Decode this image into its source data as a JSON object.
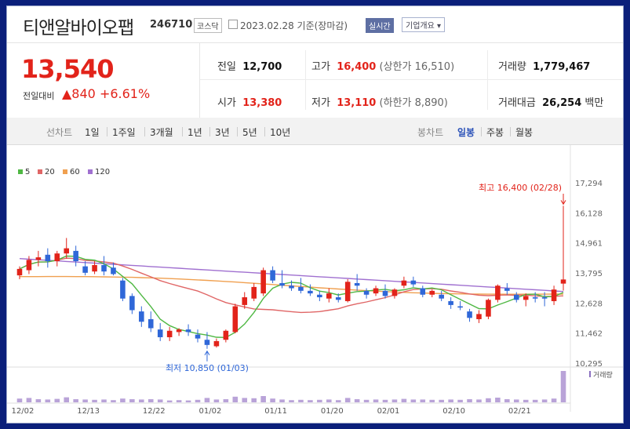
{
  "company": {
    "name": "티앤알바이오팹",
    "code": "246710",
    "market": "코스닥",
    "date": "2023.02.28",
    "basis": "기준(장마감)",
    "realtime": "실시간",
    "corp_overview": "기업개요 ▾"
  },
  "summary": {
    "price": "13,540",
    "change_label": "전일대비",
    "change_abs": "▲840",
    "change_pct": "+6.61%",
    "prev_close_label": "전일",
    "prev_close": "12,700",
    "high_label": "고가",
    "high": "16,400",
    "upper_limit_label": "(상한가",
    "upper_limit": "16,510)",
    "volume_label": "거래량",
    "volume": "1,779,467",
    "open_label": "시가",
    "open": "13,380",
    "low_label": "저가",
    "low": "13,110",
    "lower_limit_label": "(하한가",
    "lower_limit": "8,890)",
    "amount_label": "거래대금",
    "amount": "26,254",
    "amount_unit": "백만"
  },
  "tabs": {
    "line_label": "선차트",
    "periods": [
      "1일",
      "1주일",
      "3개월",
      "1년",
      "3년",
      "5년",
      "10년"
    ],
    "candle_label": "봉차트",
    "daily": "일봉",
    "weekly": "주봉",
    "monthly": "월봉"
  },
  "colors": {
    "up": "#e2231a",
    "down": "#2f67d8",
    "ma5": "#4fb843",
    "ma20": "#e06666",
    "ma60": "#f0a050",
    "ma120": "#a070d0",
    "volume": "#b9a3d8"
  },
  "chart_data": {
    "type": "candlestick",
    "legend": [
      {
        "name": "5",
        "color": "#4fb843"
      },
      {
        "name": "20",
        "color": "#e06666"
      },
      {
        "name": "60",
        "color": "#f0a050"
      },
      {
        "name": "120",
        "color": "#a070d0"
      }
    ],
    "y_ticks": [
      17294,
      16128,
      14961,
      13795,
      12628,
      11462,
      10295
    ],
    "ylim": [
      10295,
      17294
    ],
    "x_labels": [
      {
        "i": 0,
        "label": "12/02"
      },
      {
        "i": 7,
        "label": "12/13"
      },
      {
        "i": 14,
        "label": "12/22"
      },
      {
        "i": 20,
        "label": "01/02"
      },
      {
        "i": 27,
        "label": "01/11"
      },
      {
        "i": 33,
        "label": "01/20"
      },
      {
        "i": 39,
        "label": "02/01"
      },
      {
        "i": 46,
        "label": "02/10"
      },
      {
        "i": 53,
        "label": "02/21"
      }
    ],
    "high_annotation": "최고 16,400 (02/28)",
    "low_annotation": "최저 10,850 (01/03)",
    "volume_label": "거래량",
    "candles": [
      [
        13700,
        14050,
        13550,
        13950
      ],
      [
        13900,
        14450,
        13750,
        14300
      ],
      [
        14300,
        14650,
        14050,
        14400
      ],
      [
        14500,
        14750,
        14000,
        14250
      ],
      [
        14250,
        14650,
        14050,
        14550
      ],
      [
        14550,
        15150,
        14350,
        14750
      ],
      [
        14650,
        14850,
        14050,
        14250
      ],
      [
        14050,
        14250,
        13700,
        13800
      ],
      [
        13850,
        14250,
        13750,
        14100
      ],
      [
        14100,
        14450,
        13700,
        13850
      ],
      [
        14000,
        14200,
        13700,
        13750
      ],
      [
        13500,
        13600,
        12700,
        12800
      ],
      [
        12900,
        13000,
        12200,
        12350
      ],
      [
        12300,
        12500,
        11700,
        11900
      ],
      [
        12000,
        12300,
        11500,
        11650
      ],
      [
        11600,
        11850,
        11150,
        11300
      ],
      [
        11300,
        11700,
        11150,
        11550
      ],
      [
        11500,
        11650,
        11350,
        11600
      ],
      [
        11600,
        11800,
        11350,
        11500
      ],
      [
        11400,
        11600,
        11100,
        11250
      ],
      [
        11200,
        11500,
        10850,
        11000
      ],
      [
        10950,
        11250,
        10900,
        11150
      ],
      [
        11200,
        11600,
        11100,
        11550
      ],
      [
        11500,
        12600,
        11450,
        12500
      ],
      [
        12550,
        13050,
        12400,
        12850
      ],
      [
        12800,
        13400,
        12700,
        13250
      ],
      [
        13000,
        14000,
        12900,
        13900
      ],
      [
        13900,
        14050,
        13400,
        13500
      ],
      [
        13400,
        13900,
        13200,
        13300
      ],
      [
        13300,
        13500,
        13100,
        13200
      ],
      [
        13250,
        13600,
        13000,
        13100
      ],
      [
        13100,
        13350,
        12900,
        13000
      ],
      [
        12950,
        13100,
        12700,
        12850
      ],
      [
        12800,
        13200,
        12650,
        13000
      ],
      [
        12850,
        13000,
        12650,
        12750
      ],
      [
        12700,
        13550,
        12650,
        13450
      ],
      [
        13400,
        13750,
        13100,
        13300
      ],
      [
        13100,
        13200,
        12800,
        12950
      ],
      [
        13000,
        13300,
        12900,
        13200
      ],
      [
        13100,
        13350,
        12800,
        12900
      ],
      [
        12900,
        13200,
        12800,
        13150
      ],
      [
        13300,
        13650,
        13200,
        13500
      ],
      [
        13500,
        13650,
        13250,
        13350
      ],
      [
        13200,
        13300,
        12850,
        12950
      ],
      [
        12950,
        13150,
        12850,
        13100
      ],
      [
        12950,
        13100,
        12700,
        12800
      ],
      [
        12700,
        12850,
        12400,
        12550
      ],
      [
        12500,
        12700,
        12350,
        12450
      ],
      [
        12300,
        12400,
        11900,
        12050
      ],
      [
        12000,
        12350,
        11850,
        12200
      ],
      [
        12100,
        12800,
        12000,
        12750
      ],
      [
        12750,
        13350,
        12650,
        13300
      ],
      [
        13200,
        13400,
        12950,
        13100
      ],
      [
        12950,
        13050,
        12650,
        12750
      ],
      [
        12750,
        13000,
        12500,
        12900
      ],
      [
        12850,
        13050,
        12650,
        12800
      ],
      [
        12850,
        13050,
        12500,
        12800
      ],
      [
        12700,
        13300,
        12550,
        13150
      ],
      [
        13380,
        16400,
        13110,
        13540
      ]
    ],
    "volumes": [
      12,
      14,
      10,
      9,
      11,
      16,
      10,
      9,
      8,
      9,
      7,
      12,
      10,
      9,
      10,
      9,
      6,
      7,
      6,
      8,
      14,
      9,
      10,
      18,
      14,
      13,
      20,
      12,
      9,
      7,
      8,
      7,
      8,
      9,
      7,
      14,
      10,
      8,
      9,
      8,
      9,
      11,
      9,
      9,
      8,
      8,
      9,
      8,
      10,
      9,
      13,
      15,
      10,
      9,
      8,
      8,
      9,
      12,
      100
    ]
  }
}
